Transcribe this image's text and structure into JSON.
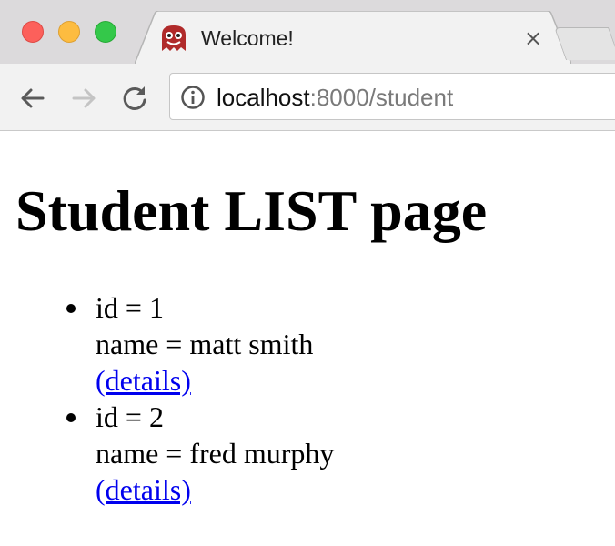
{
  "browser": {
    "tab": {
      "title": "Welcome!",
      "close_glyph": "×",
      "favicon": "ghost-face-icon"
    },
    "address_bar": {
      "host": "localhost",
      "rest": ":8000/student"
    },
    "colors": {
      "close": "#fc605b",
      "minimize": "#fdbc40",
      "maximize": "#34c84a",
      "link": "#0000ee"
    }
  },
  "page": {
    "title": "Student LIST page",
    "students": [
      {
        "id_text": "id = 1",
        "name_text": "name = matt smith",
        "link_label": "(details)"
      },
      {
        "id_text": "id = 2",
        "name_text": "name = fred murphy",
        "link_label": "(details)"
      }
    ]
  }
}
